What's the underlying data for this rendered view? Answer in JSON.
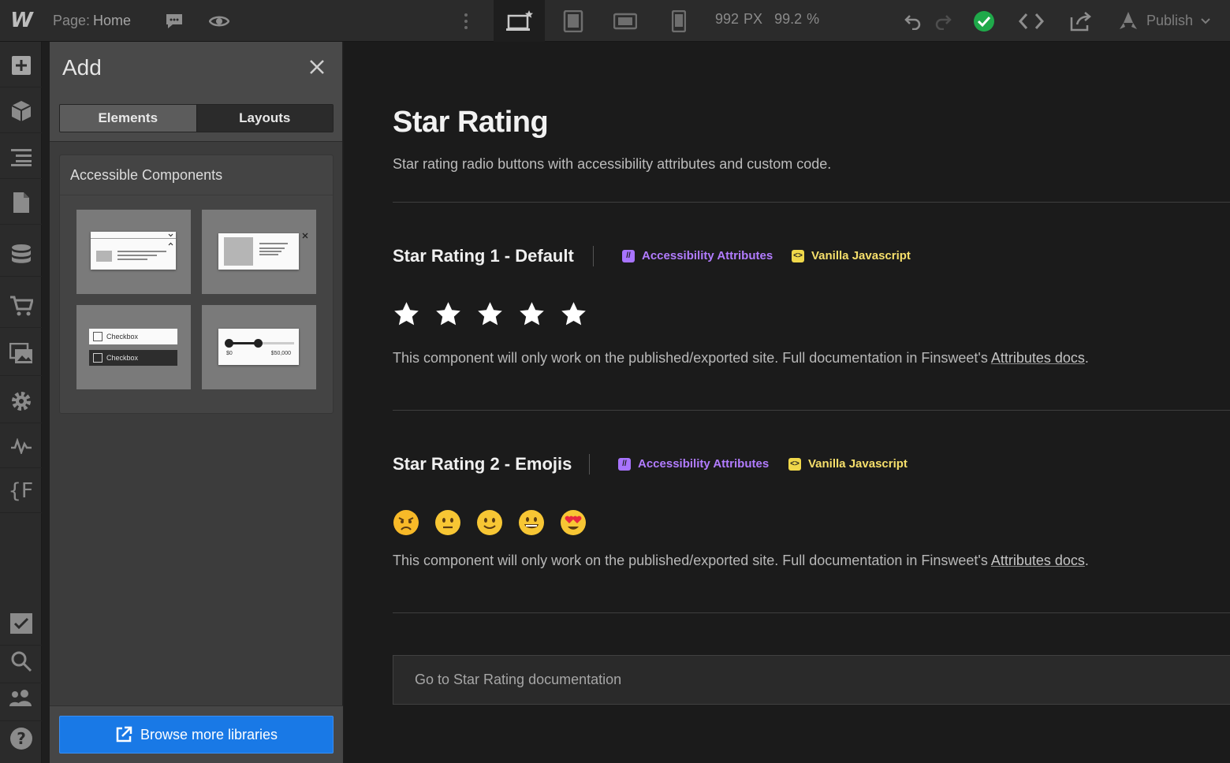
{
  "topbar": {
    "logo": "W",
    "page_prefix": "Page:",
    "page_name": "Home",
    "width_value": "992",
    "width_unit": "PX",
    "zoom_value": "99.2",
    "zoom_unit": "%",
    "publish_label": "Publish",
    "icons": [
      "comment-icon",
      "preview-eye-icon",
      "more-vertical-icon",
      "desktop-star-icon",
      "tablet-icon",
      "mobile-landscape-icon",
      "mobile-portrait-icon",
      "undo-icon",
      "redo-icon",
      "status-check-icon",
      "code-icon",
      "export-icon",
      "publish-rocket-icon"
    ]
  },
  "leftbar": {
    "icons": [
      "add-icon",
      "components-cube-icon",
      "navigator-icon",
      "pages-icon",
      "cms-database-icon",
      "ecommerce-cart-icon",
      "assets-images-icon",
      "settings-gear-icon",
      "activity-icon",
      "finsweet-extension-icon",
      "tasks-check-icon",
      "search-icon",
      "users-icon",
      "help-icon"
    ]
  },
  "panel": {
    "title": "Add",
    "tabs": [
      {
        "label": "Elements",
        "active": true
      },
      {
        "label": "Layouts",
        "active": false
      }
    ],
    "library_title": "Accessible Components",
    "tiles": [
      {
        "name": "dropdown-component"
      },
      {
        "name": "modal-component"
      },
      {
        "name": "checkbox-component",
        "rows": [
          "Checkbox",
          "Checkbox"
        ]
      },
      {
        "name": "range-slider-component",
        "min_label": "$0",
        "max_label": "$50,000"
      }
    ],
    "browse_label": "Browse more libraries",
    "browse_color": "#1979e6"
  },
  "main": {
    "title": "Star Rating",
    "subtitle": "Star rating radio buttons with accessibility attributes and custom code.",
    "sections": [
      {
        "title": "Star Rating 1 - Default",
        "badge_attr": "Accessibility Attributes",
        "badge_js": "Vanilla Javascript",
        "rating_type": "stars",
        "items": 5,
        "note_prefix": "This component will only work on the published/exported site. Full documentation in Finsweet's ",
        "note_link": "Attributes docs",
        "note_suffix": "."
      },
      {
        "title": "Star Rating 2 - Emojis",
        "badge_attr": "Accessibility Attributes",
        "badge_js": "Vanilla Javascript",
        "rating_type": "emojis",
        "emojis": [
          "angry-emoji",
          "neutral-emoji",
          "slight-smile-emoji",
          "grin-emoji",
          "heart-eyes-emoji"
        ],
        "note_prefix": "This component will only work on the published/exported site. Full documentation in Finsweet's ",
        "note_link": "Attributes docs",
        "note_suffix": "."
      }
    ],
    "doc_button": "Go to Star Rating documentation",
    "accent_attr": "#b27cff",
    "accent_js": "#f6df6b"
  }
}
